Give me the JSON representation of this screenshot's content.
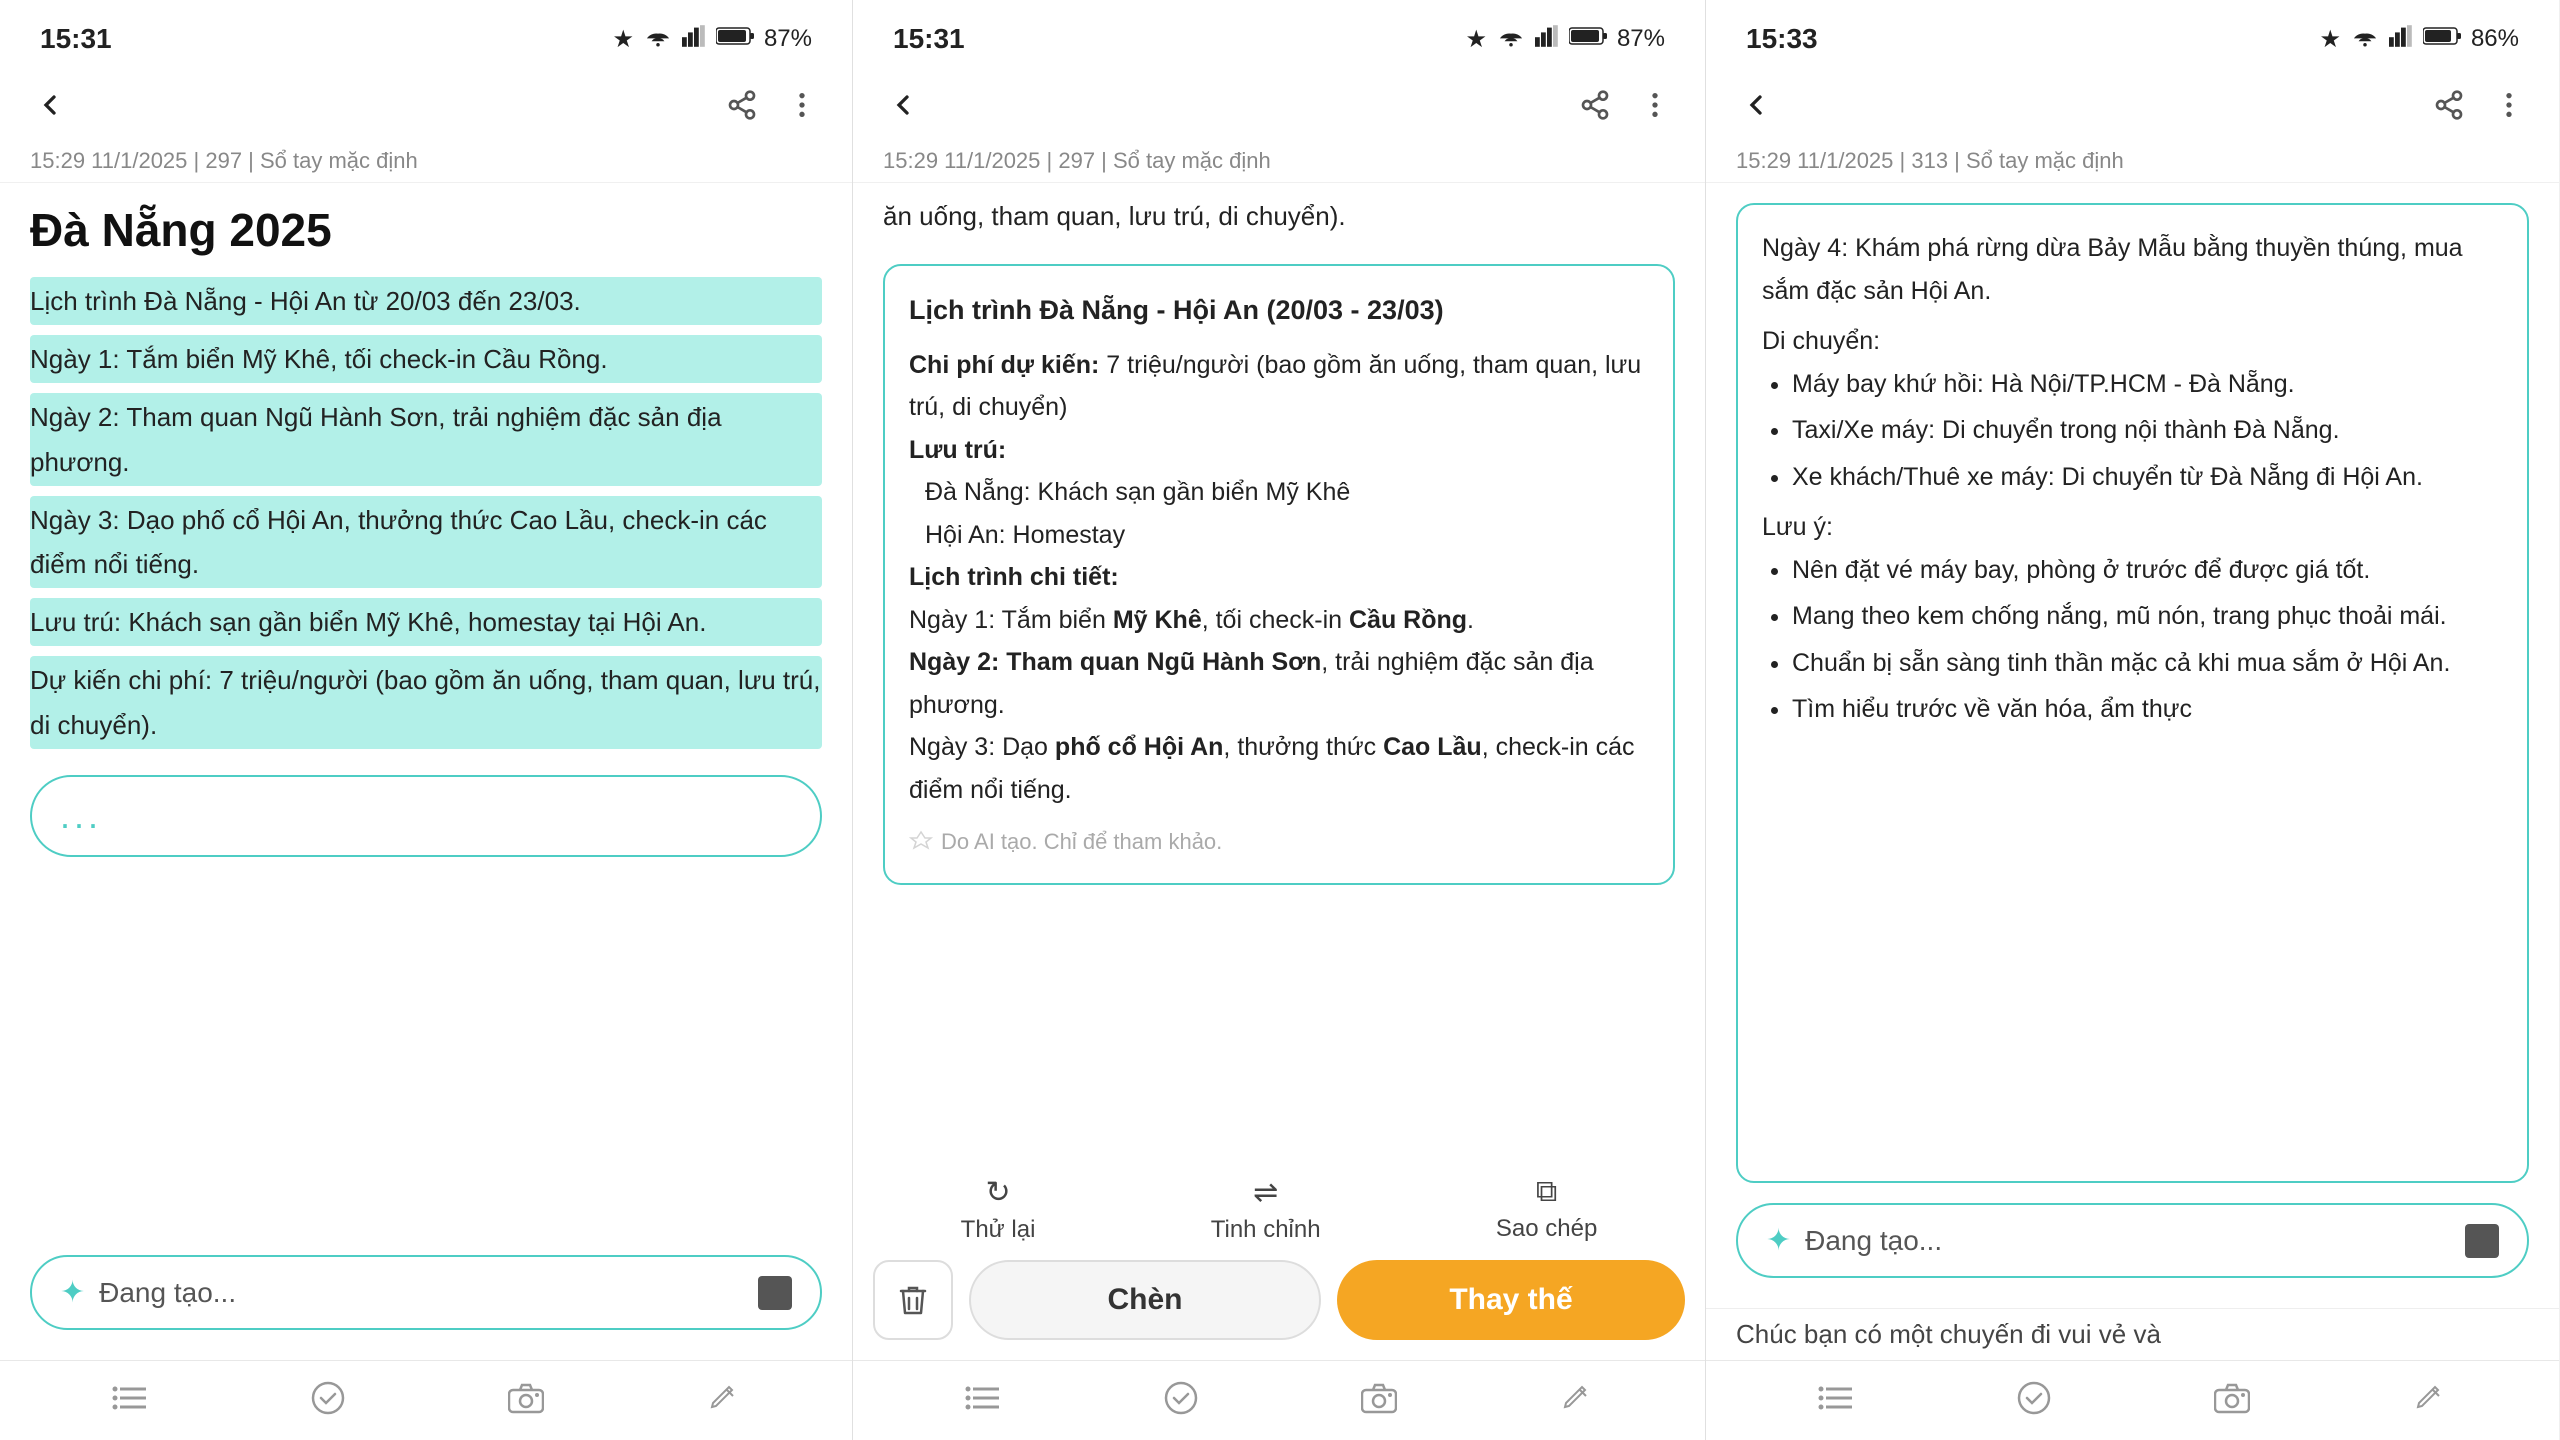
{
  "screen1": {
    "time": "15:31",
    "battery": "87%",
    "meta": "15:29 11/1/2025  |  297  |  Sổ tay mặc định",
    "title": "Đà Nẵng 2025",
    "highlight1": "Lịch trình Đà Nẵng - Hội An từ 20/03 đến 23/03.",
    "highlight2": "Ngày 1: Tắm biển Mỹ Khê, tối check-in Cầu Rồng.",
    "highlight3": "Ngày 2: Tham quan Ngũ Hành Sơn, trải nghiệm đặc sản địa phương.",
    "highlight4": "Ngày 3: Dạo phố cổ Hội An, thưởng thức Cao Lầu, check-in các điểm nổi tiếng.",
    "highlight5": "Lưu trú: Khách sạn gần biển Mỹ Khê, homestay tại Hội An.",
    "highlight6": "Dự kiến chi phí: 7 triệu/người (bao gồm ăn uống, tham quan, lưu trú, di chuyển).",
    "generating_label": "Đang tạo...",
    "ellipsis": "..."
  },
  "screen2": {
    "time": "15:31",
    "battery": "87%",
    "meta": "15:29 11/1/2025  |  297  |  Sổ tay mặc định",
    "cut_text": "ăn uống, tham quan, lưu trú, di chuyển).",
    "ai_box": {
      "header": "Lịch trình Đà Nẵng - Hội An (20/03 - 23/03)",
      "cost": "Chi phí dự kiến: 7 triệu/người (bao gồm ăn uống, tham quan, lưu trú, di chuyển)",
      "stay_label": "Lưu trú:",
      "stay1": "Đà Nẵng: Khách sạn gần biển Mỹ Khê",
      "stay2": "Hội An: Homestay",
      "detail_label": "Lịch trình chi tiết:",
      "day1": "Ngày 1: Tắm biển Mỹ Khê, tối check-in Cầu Rồng.",
      "day2_pre": "Ngày 2:",
      "day2_bold": "Tham quan Ngũ Hành Sơn",
      "day2_post": ", trải nghiệm đặc sản địa phương.",
      "day3_pre": "Ngày 3: Dạo",
      "day3_bold": "phố cổ Hội An",
      "day3_mid": ", thưởng thức",
      "day3_bold2": "Cao Lầu",
      "day3_post": ", check-in các điểm nổi tiếng.",
      "ai_label": "Do AI tạo. Chỉ để tham khảo."
    },
    "actions": {
      "retry": "Thử lại",
      "adjust": "Tinh chỉnh",
      "copy": "Sao chép",
      "delete_icon": "🗑",
      "insert": "Chèn",
      "replace": "Thay thế"
    }
  },
  "screen3": {
    "time": "15:33",
    "battery": "86%",
    "meta": "15:29 11/1/2025  |  313  |  Sổ tay mặc định",
    "ai_content": {
      "day4": "Ngày 4: Khám phá rừng dừa Bảy Mẫu bằng thuyền thúng, mua sắm đặc sản Hội An.",
      "move_label": "Di chuyển:",
      "move1": "Máy bay khứ hồi: Hà Nội/TP.HCM - Đà Nẵng.",
      "move2": "Taxi/Xe máy: Di chuyển trong nội thành Đà Nẵng.",
      "move3": "Xe khách/Thuê xe máy: Di chuyển từ Đà Nẵng đi Hội An.",
      "note_label": "Lưu ý:",
      "note1": "Nên đặt vé máy bay, phòng ở trước để được giá tốt.",
      "note2": "Mang theo kem chống nắng, mũ nón, trang phục thoải mái.",
      "note3": "Chuẩn bị sẵn sàng tinh thần mặc cả khi mua sắm ở Hội An.",
      "note4": "Tìm hiểu trước về văn hóa, ẩm thực"
    },
    "generating_label": "Đang tạo...",
    "bottom_text": "Chúc bạn có một chuyến đi vui vẻ và"
  }
}
